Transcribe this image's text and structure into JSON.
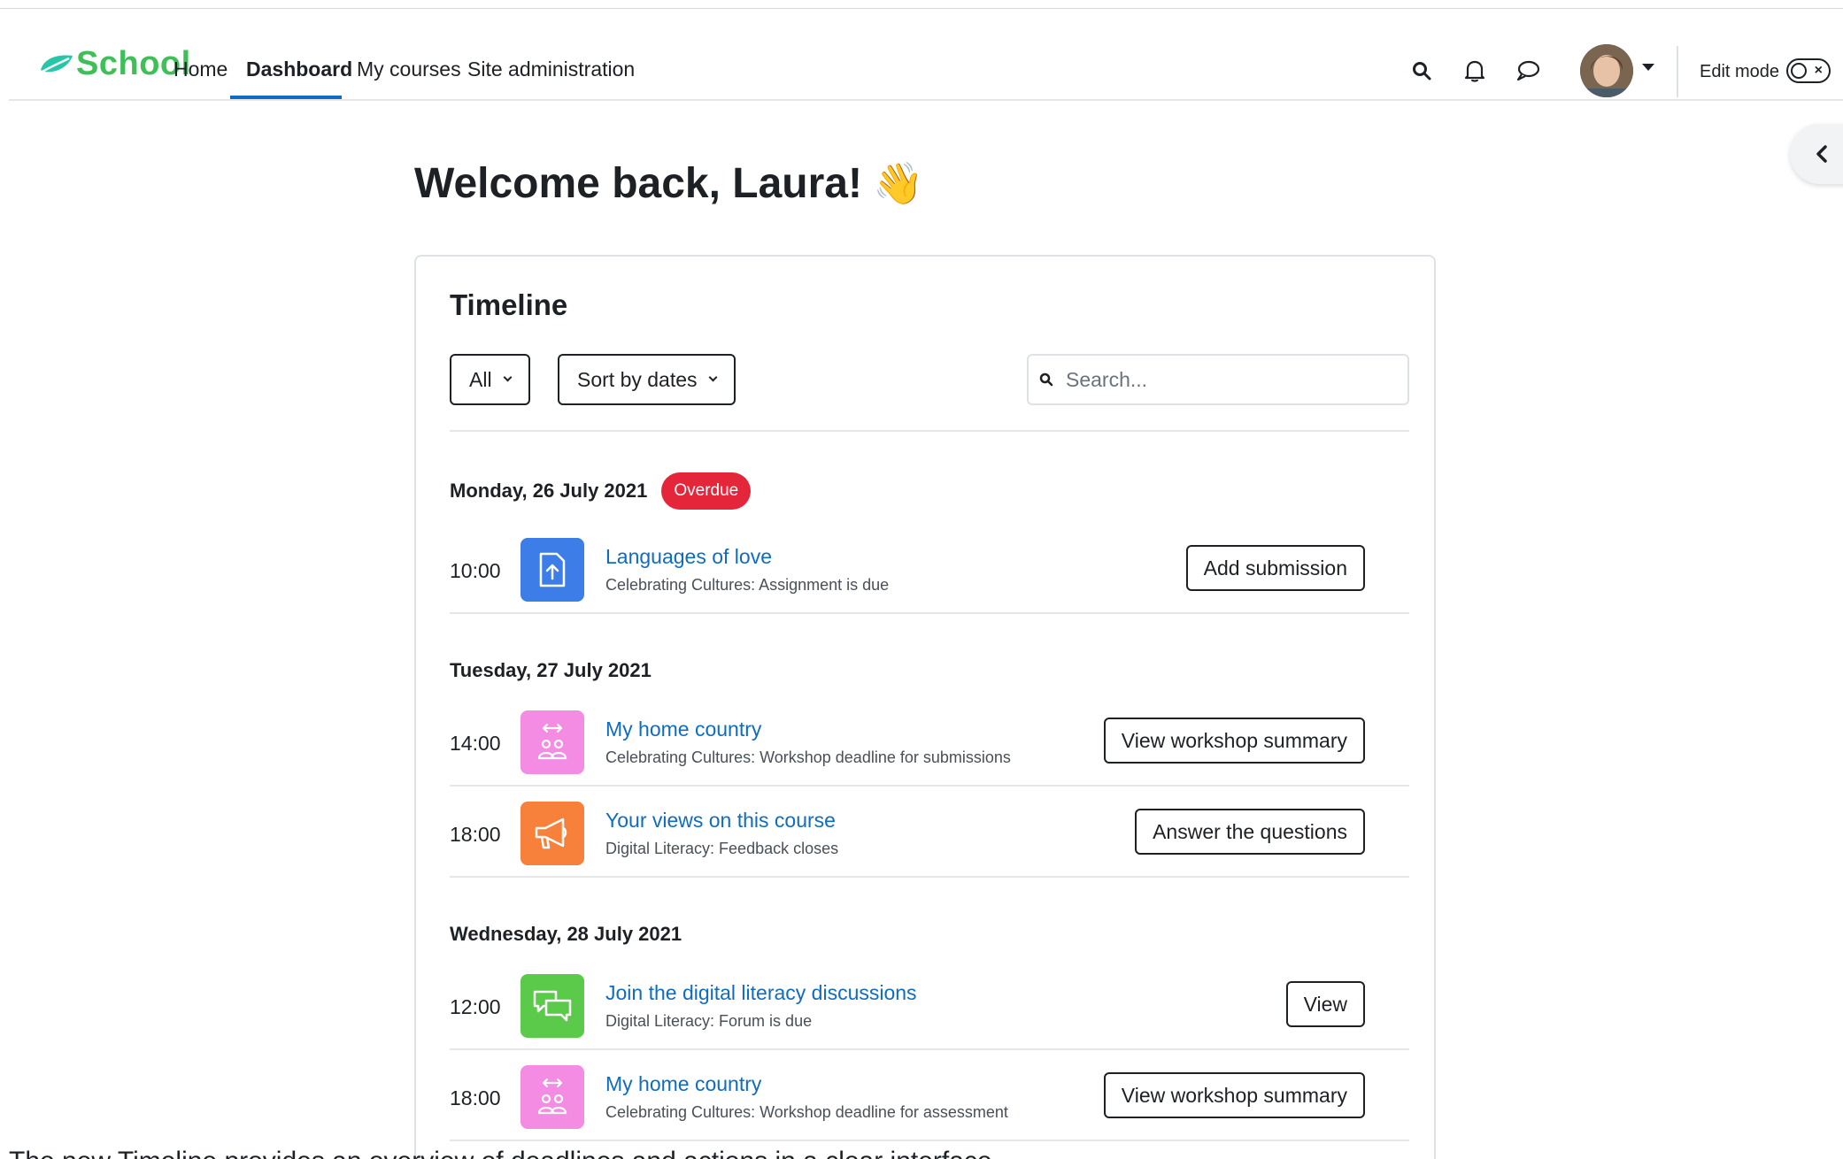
{
  "brand": {
    "name": "School"
  },
  "nav": {
    "items": [
      {
        "label": "Home"
      },
      {
        "label": "Dashboard"
      },
      {
        "label": "My courses"
      },
      {
        "label": "Site administration"
      }
    ],
    "edit_mode_label": "Edit mode"
  },
  "page": {
    "welcome": "Welcome back, Laura!",
    "welcome_emoji": "👋"
  },
  "timeline": {
    "title": "Timeline",
    "filter_label": "All",
    "sort_label": "Sort by dates",
    "search_placeholder": "Search...",
    "groups": [
      {
        "date": "Monday, 26 July 2021",
        "badge": "Overdue",
        "items": [
          {
            "time": "10:00",
            "title": "Languages of love",
            "subtitle": "Celebrating Cultures: Assignment is due",
            "action": "Add submission",
            "icon": "assignment-upload-icon",
            "color": "#3d7de8"
          }
        ]
      },
      {
        "date": "Tuesday, 27 July 2021",
        "items": [
          {
            "time": "14:00",
            "title": "My home country",
            "subtitle": "Celebrating Cultures: Workshop deadline for submissions",
            "action": "View workshop summary",
            "icon": "workshop-icon",
            "color": "#f48ce3"
          },
          {
            "time": "18:00",
            "title": "Your views on this course",
            "subtitle": "Digital Literacy: Feedback closes",
            "action": "Answer the questions",
            "icon": "megaphone-icon",
            "color": "#f7803a"
          }
        ]
      },
      {
        "date": "Wednesday, 28 July 2021",
        "items": [
          {
            "time": "12:00",
            "title": "Join the digital literacy discussions",
            "subtitle": "Digital Literacy: Forum is due",
            "action": "View",
            "icon": "forum-icon",
            "color": "#5bc94a"
          },
          {
            "time": "18:00",
            "title": "My home country",
            "subtitle": "Celebrating Cultures: Workshop deadline for assessment",
            "action": "View workshop summary",
            "icon": "workshop-icon",
            "color": "#f48ce3"
          }
        ]
      }
    ]
  },
  "caption": "The new Timeline provides an overview of deadlines and actions in a clear interface.",
  "colors": {
    "brand": "#3fbf58",
    "link": "#0f6cbf",
    "overdue": "#e5253a"
  }
}
